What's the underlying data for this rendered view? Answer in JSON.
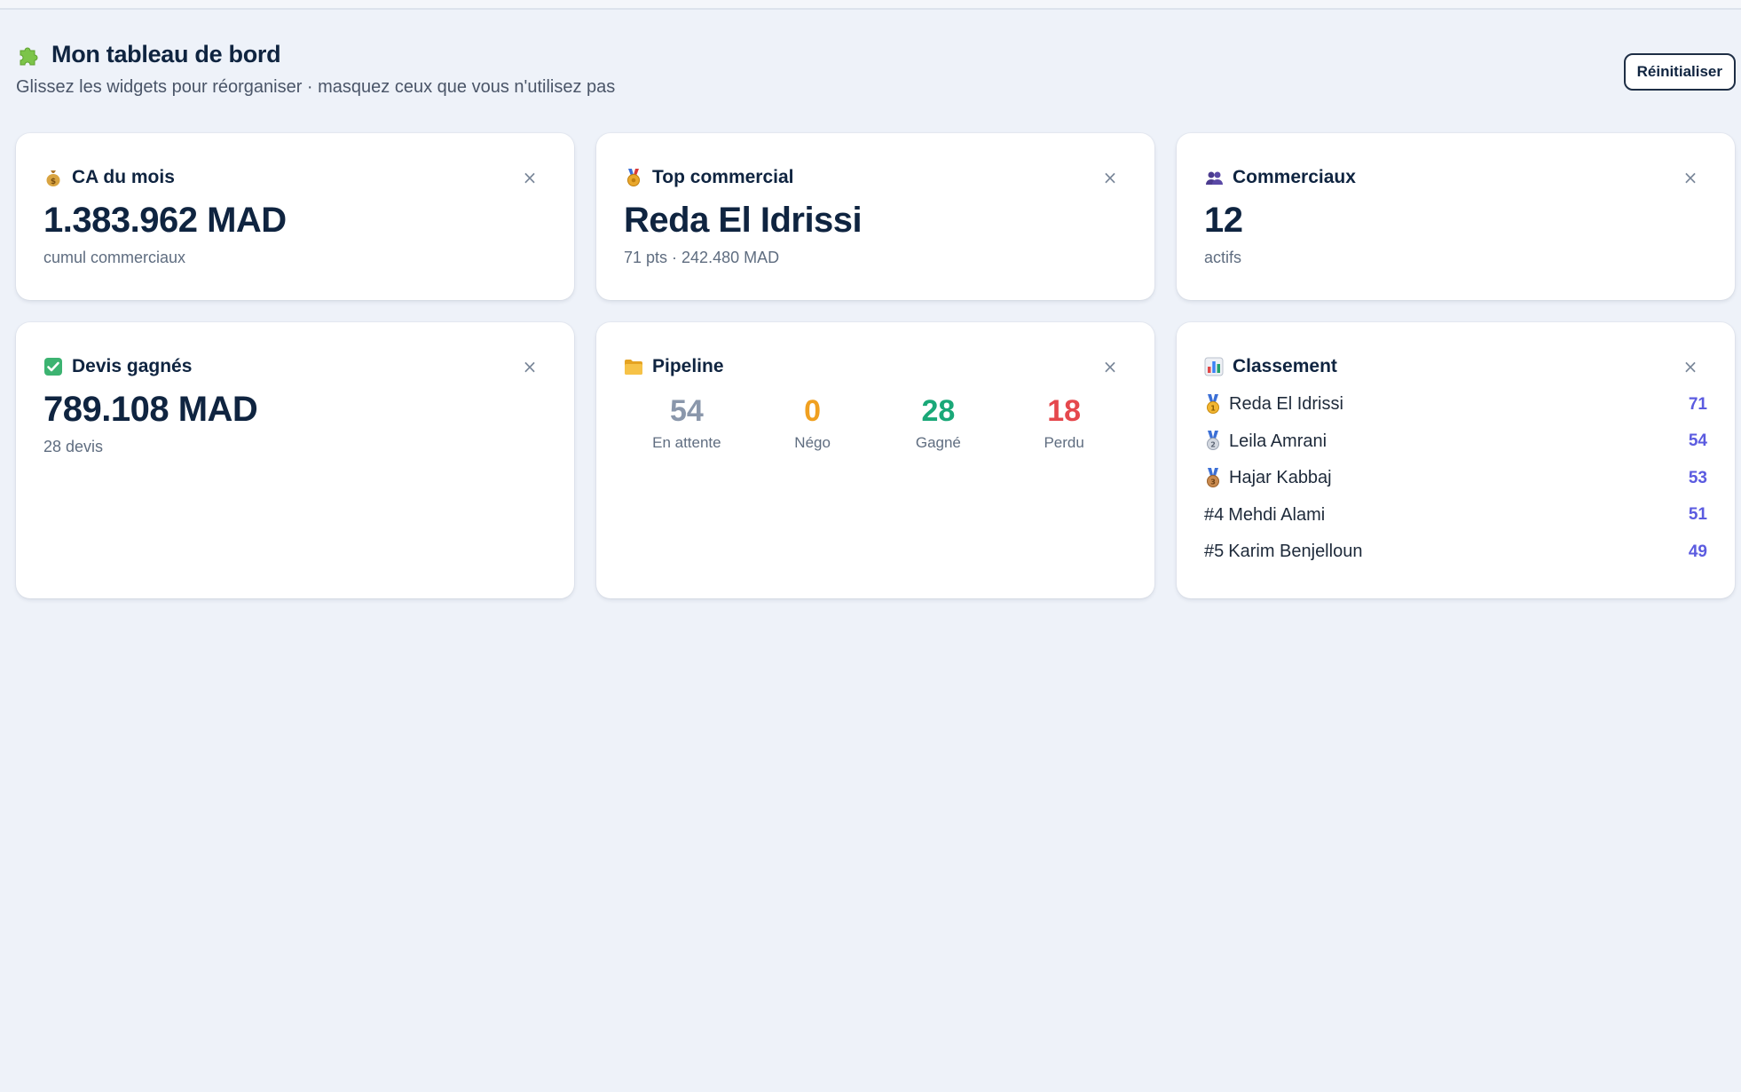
{
  "header": {
    "title": "Mon tableau de bord",
    "subtitle": "Glissez les widgets pour réorganiser · masquez ceux que vous n'utilisez pas",
    "reset_label": "Réinitialiser",
    "icon": "puzzle-icon"
  },
  "close_glyph": "×",
  "widgets": {
    "ca": {
      "title": "CA du mois",
      "icon": "money-bag-icon",
      "value": "1.383.962 MAD",
      "sub": "cumul commerciaux"
    },
    "top": {
      "title": "Top commercial",
      "icon": "medal-icon",
      "value": "Reda El Idrissi",
      "sub": "71 pts · 242.480 MAD"
    },
    "commerciaux": {
      "title": "Commerciaux",
      "icon": "people-icon",
      "value": "12",
      "sub": "actifs"
    },
    "devis": {
      "title": "Devis gagnés",
      "icon": "check-icon",
      "value": "789.108 MAD",
      "sub": "28 devis"
    },
    "pipeline": {
      "title": "Pipeline",
      "icon": "folder-icon",
      "stages": [
        {
          "value": "54",
          "label": "En attente",
          "color": "#8a97ab"
        },
        {
          "value": "0",
          "label": "Négo",
          "color": "#f0a020"
        },
        {
          "value": "28",
          "label": "Gagné",
          "color": "#1aa878"
        },
        {
          "value": "18",
          "label": "Perdu",
          "color": "#e5484d"
        }
      ]
    },
    "classement": {
      "title": "Classement",
      "icon": "bar-chart-icon",
      "items": [
        {
          "rank": "",
          "name": "Reda El Idrissi",
          "score": "71",
          "medal": "gold-medal-icon"
        },
        {
          "rank": "",
          "name": "Leila Amrani",
          "score": "54",
          "medal": "silver-medal-icon"
        },
        {
          "rank": "",
          "name": "Hajar Kabbaj",
          "score": "53",
          "medal": "bronze-medal-icon"
        },
        {
          "rank": "#4",
          "name": "Mehdi Alami",
          "score": "51",
          "medal": ""
        },
        {
          "rank": "#5",
          "name": "Karim Benjelloun",
          "score": "49",
          "medal": ""
        }
      ]
    }
  },
  "colors": {
    "accent": "#5b5be0",
    "text": "#0f2440",
    "background": "#eef2f9"
  }
}
